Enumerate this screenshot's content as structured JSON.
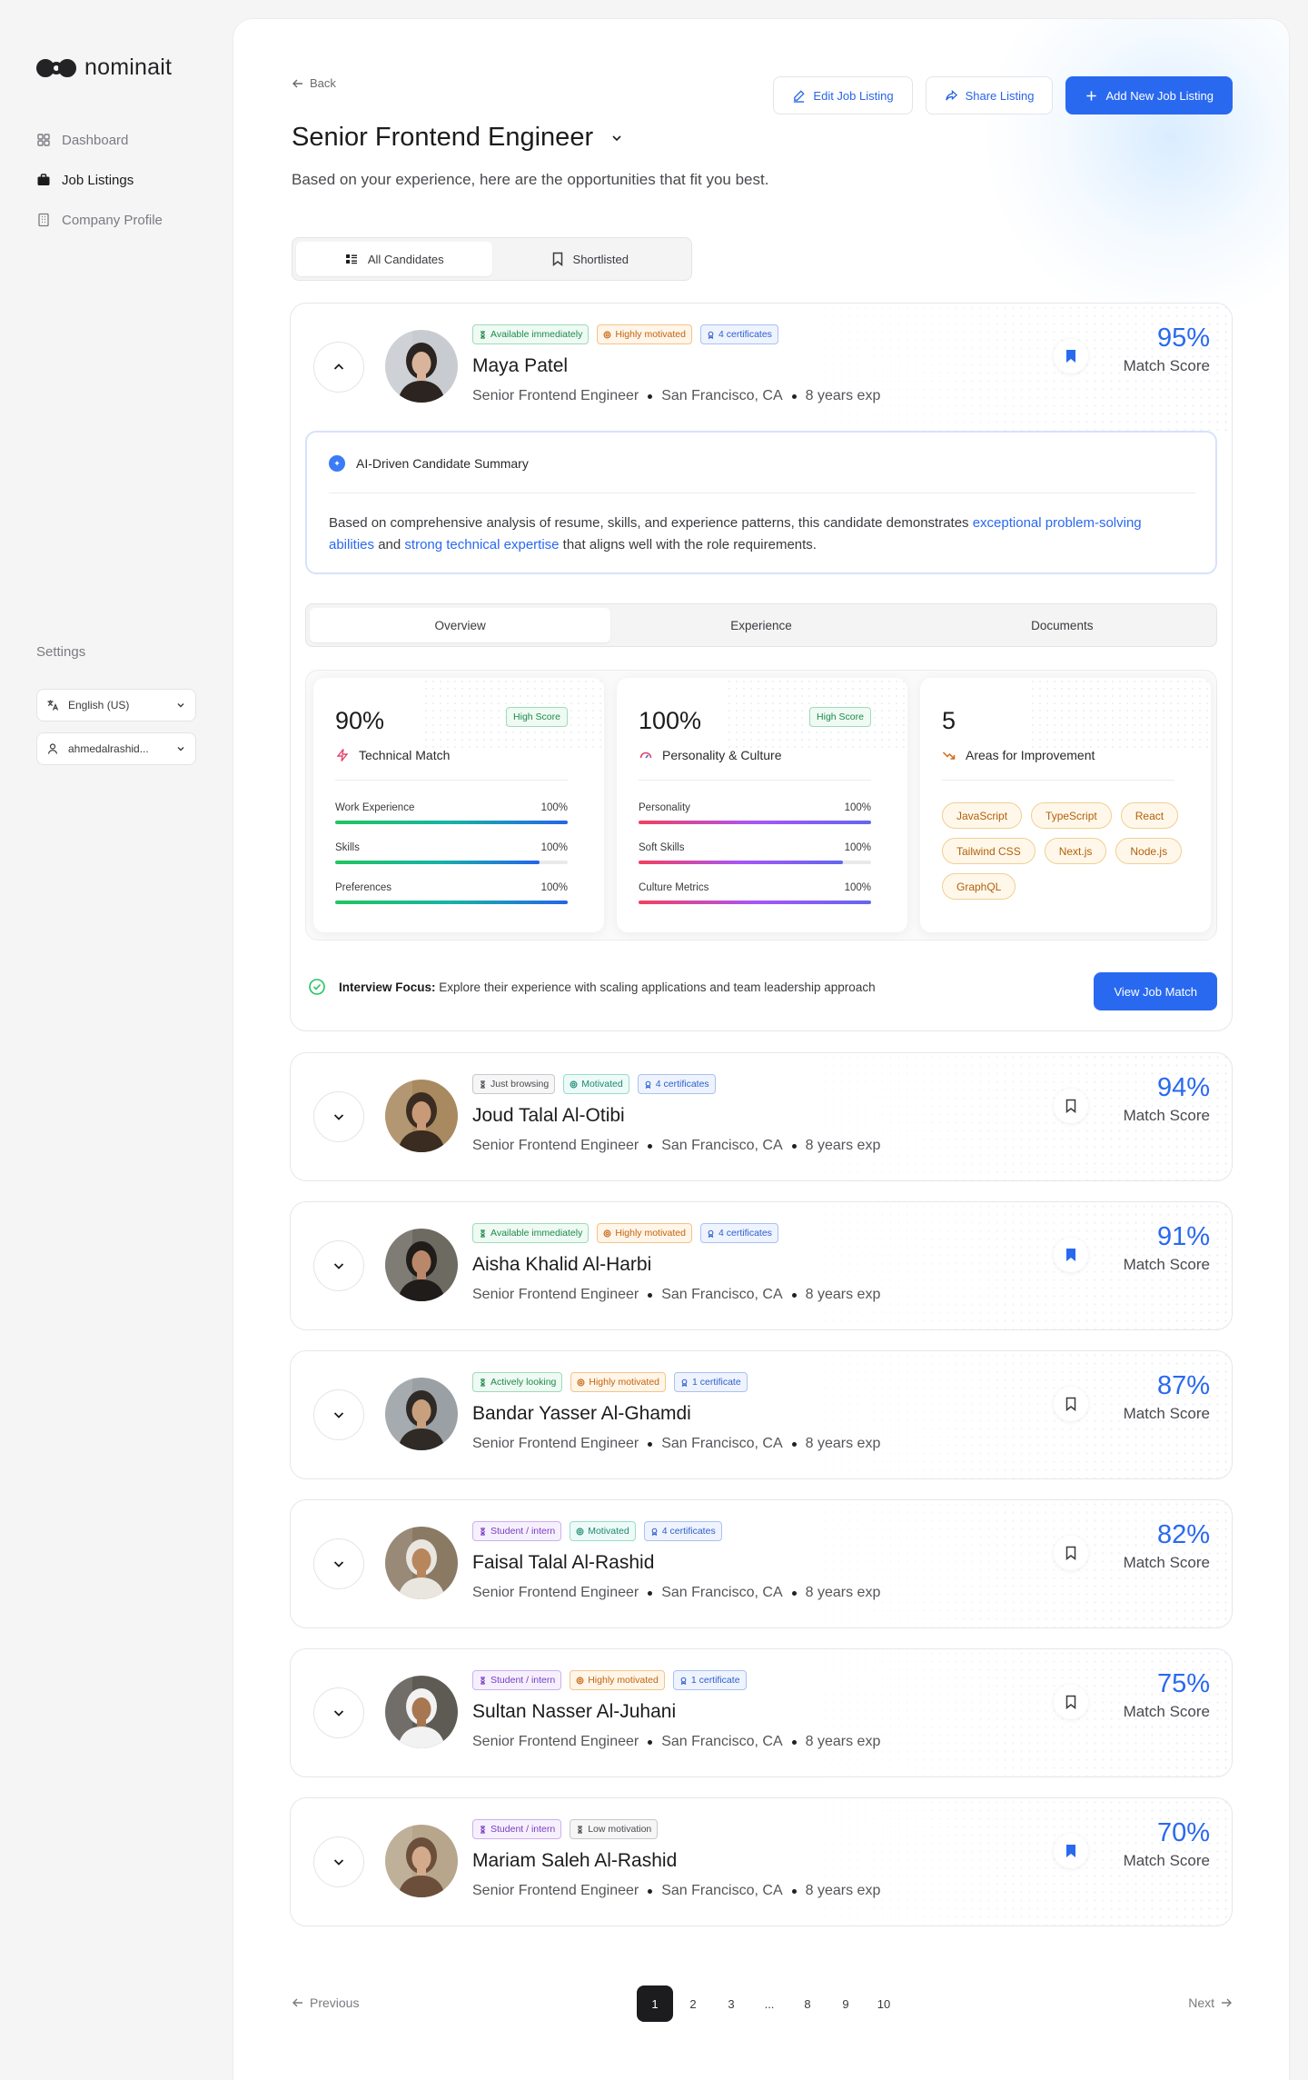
{
  "brand": {
    "name": "nominait"
  },
  "nav": {
    "items": [
      {
        "label": "Dashboard",
        "icon": "grid-icon"
      },
      {
        "label": "Job Listings",
        "icon": "briefcase-icon"
      },
      {
        "label": "Company Profile",
        "icon": "building-icon"
      }
    ],
    "active": "Job Listings"
  },
  "settings": {
    "label": "Settings",
    "language": "English (US)",
    "user": "ahmedalrashid..."
  },
  "header": {
    "back": "Back",
    "edit": "Edit Job Listing",
    "share": "Share Listing",
    "add": "Add New Job Listing",
    "title": "Senior Frontend Engineer",
    "subtitle": "Based on your experience, here are the opportunities that fit you best."
  },
  "filter_tabs": {
    "all": "All Candidates",
    "shortlisted": "Shortlisted"
  },
  "colors": {
    "accent": "#2969f0",
    "dark": "#1c1c1e"
  },
  "expanded": {
    "ai_title": "AI-Driven Candidate Summary",
    "ai_text_1": "Based on comprehensive analysis of resume, skills, and experience patterns, this candidate demonstrates ",
    "ai_hl_1": "exceptional problem-solving abilities",
    "ai_text_2": " and ",
    "ai_hl_2": "strong technical expertise",
    "ai_text_3": " that aligns well with the role requirements.",
    "tabs": [
      "Overview",
      "Experience",
      "Documents"
    ],
    "technical": {
      "value": "90%",
      "badge": "High Score",
      "title": "Technical Match",
      "rows": [
        {
          "label": "Work Experience",
          "value": "100%",
          "fill": 1.0
        },
        {
          "label": "Skills",
          "value": "100%",
          "fill": 0.88
        },
        {
          "label": "Preferences",
          "value": "100%",
          "fill": 1.0
        }
      ]
    },
    "personality": {
      "value": "100%",
      "badge": "High Score",
      "title": "Personality & Culture",
      "rows": [
        {
          "label": "Personality",
          "value": "100%",
          "fill": 1.0
        },
        {
          "label": "Soft Skills",
          "value": "100%",
          "fill": 0.88
        },
        {
          "label": "Culture Metrics",
          "value": "100%",
          "fill": 1.0
        }
      ]
    },
    "improvement": {
      "value": "5",
      "title": "Areas for Improvement",
      "chips": [
        "JavaScript",
        "TypeScript",
        "React",
        "Tailwind CSS",
        "Next.js",
        "Node.js",
        "GraphQL"
      ]
    },
    "interview_label": "Interview Focus:",
    "interview_text": "Explore their experience with scaling applications and team leadership approach",
    "view_button": "View Job Match"
  },
  "candidates": [
    {
      "name": "Maya Patel",
      "role": "Senior Frontend Engineer",
      "location": "San Francisco, CA",
      "exp": "8 years exp",
      "score": "95%",
      "score_label": "Match Score",
      "bookmarked": true,
      "badges": [
        {
          "text": "Available immediately",
          "type": "green"
        },
        {
          "text": "Highly motivated",
          "type": "orange"
        },
        {
          "text": "4 certificates",
          "type": "blue"
        }
      ]
    },
    {
      "name": "Joud Talal Al-Otibi",
      "role": "Senior Frontend Engineer",
      "location": "San Francisco, CA",
      "exp": "8 years exp",
      "score": "94%",
      "score_label": "Match Score",
      "bookmarked": false,
      "badges": [
        {
          "text": "Just browsing",
          "type": "gray"
        },
        {
          "text": "Motivated",
          "type": "teal"
        },
        {
          "text": "4 certificates",
          "type": "blue"
        }
      ]
    },
    {
      "name": "Aisha Khalid Al-Harbi",
      "role": "Senior Frontend Engineer",
      "location": "San Francisco, CA",
      "exp": "8 years exp",
      "score": "91%",
      "score_label": "Match Score",
      "bookmarked": true,
      "badges": [
        {
          "text": "Available immediately",
          "type": "green"
        },
        {
          "text": "Highly motivated",
          "type": "orange"
        },
        {
          "text": "4 certificates",
          "type": "blue"
        }
      ]
    },
    {
      "name": "Bandar Yasser Al-Ghamdi",
      "role": "Senior Frontend Engineer",
      "location": "San Francisco, CA",
      "exp": "8 years exp",
      "score": "87%",
      "score_label": "Match Score",
      "bookmarked": false,
      "badges": [
        {
          "text": "Actively looking",
          "type": "green"
        },
        {
          "text": "Highly motivated",
          "type": "orange"
        },
        {
          "text": "1 certificate",
          "type": "blue"
        }
      ]
    },
    {
      "name": "Faisal Talal Al-Rashid",
      "role": "Senior Frontend Engineer",
      "location": "San Francisco, CA",
      "exp": "8 years exp",
      "score": "82%",
      "score_label": "Match Score",
      "bookmarked": false,
      "badges": [
        {
          "text": "Student / intern",
          "type": "purple"
        },
        {
          "text": "Motivated",
          "type": "teal"
        },
        {
          "text": "4 certificates",
          "type": "blue"
        }
      ]
    },
    {
      "name": "Sultan Nasser Al-Juhani",
      "role": "Senior Frontend Engineer",
      "location": "San Francisco, CA",
      "exp": "8 years exp",
      "score": "75%",
      "score_label": "Match Score",
      "bookmarked": false,
      "badges": [
        {
          "text": "Student / intern",
          "type": "purple"
        },
        {
          "text": "Highly motivated",
          "type": "orange"
        },
        {
          "text": "1 certificate",
          "type": "blue"
        }
      ]
    },
    {
      "name": "Mariam Saleh Al-Rashid",
      "role": "Senior Frontend Engineer",
      "location": "San Francisco, CA",
      "exp": "8 years exp",
      "score": "70%",
      "score_label": "Match Score",
      "bookmarked": true,
      "badges": [
        {
          "text": "Student / intern",
          "type": "purple"
        },
        {
          "text": "Low motivation",
          "type": "gray"
        }
      ]
    }
  ],
  "pagination": {
    "previous": "Previous",
    "next": "Next",
    "pages": [
      "1",
      "2",
      "3",
      "...",
      "8",
      "9",
      "10"
    ],
    "current": "1"
  }
}
